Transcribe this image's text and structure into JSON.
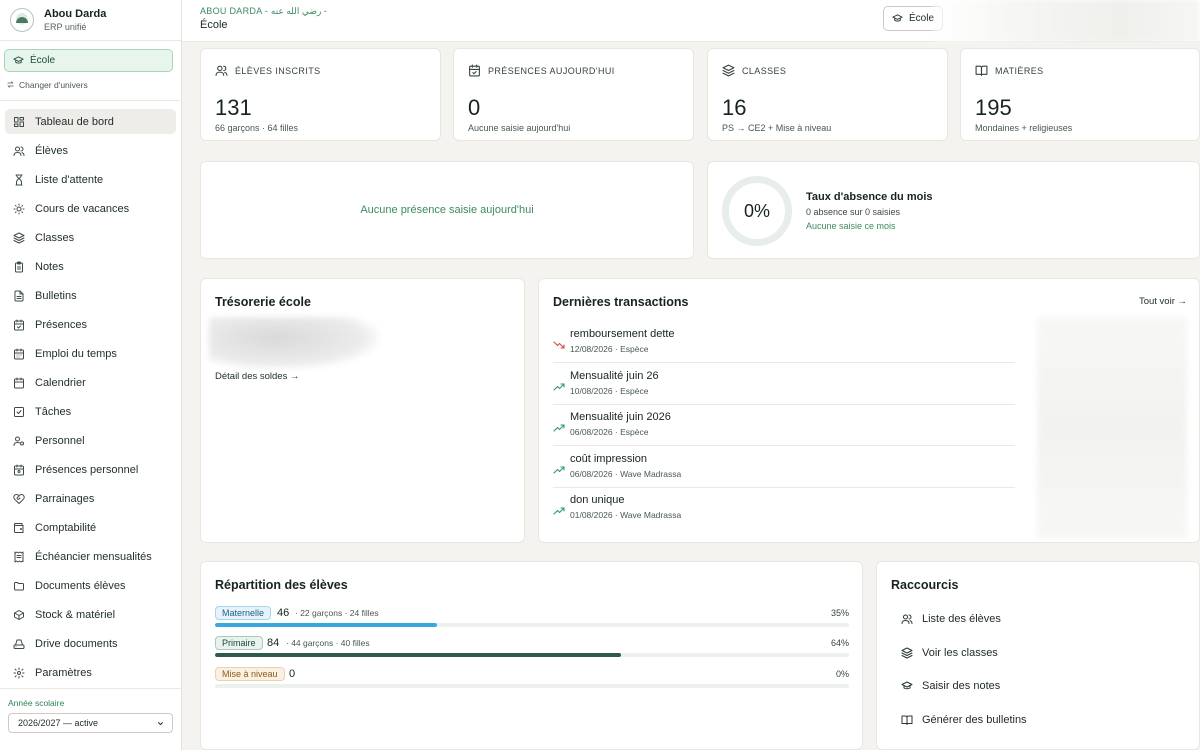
{
  "brand": {
    "name": "Abou Darda",
    "subtitle": "ERP unifié"
  },
  "univers": {
    "label": "École",
    "switch_label": "Changer d'univers"
  },
  "nav": [
    {
      "label": "Tableau de bord",
      "icon": "dashboard-icon",
      "active": true
    },
    {
      "label": "Élèves",
      "icon": "users-icon"
    },
    {
      "label": "Liste d'attente",
      "icon": "hourglass-icon"
    },
    {
      "label": "Cours de vacances",
      "icon": "sun-icon"
    },
    {
      "label": "Classes",
      "icon": "layers-icon"
    },
    {
      "label": "Notes",
      "icon": "clipboard-icon"
    },
    {
      "label": "Bulletins",
      "icon": "file-icon"
    },
    {
      "label": "Présences",
      "icon": "calendar-check-icon"
    },
    {
      "label": "Emploi du temps",
      "icon": "calendar-grid-icon"
    },
    {
      "label": "Calendrier",
      "icon": "calendar-icon"
    },
    {
      "label": "Tâches",
      "icon": "checkbox-icon"
    },
    {
      "label": "Personnel",
      "icon": "user-gear-icon"
    },
    {
      "label": "Présences personnel",
      "icon": "calendar-user-icon"
    },
    {
      "label": "Parrainages",
      "icon": "heart-handshake-icon"
    },
    {
      "label": "Comptabilité",
      "icon": "wallet-icon"
    },
    {
      "label": "Échéancier mensualités",
      "icon": "receipt-icon"
    },
    {
      "label": "Documents élèves",
      "icon": "folder-icon"
    },
    {
      "label": "Stock & matériel",
      "icon": "box-icon"
    },
    {
      "label": "Drive documents",
      "icon": "drive-icon"
    },
    {
      "label": "Paramètres",
      "icon": "settings-icon"
    }
  ],
  "year": {
    "label": "Année scolaire",
    "value": "2026/2027 — active"
  },
  "header": {
    "breadcrumb": "ABOU DARDA - رضي الله عنه -",
    "title": "École",
    "school_button": "École"
  },
  "stats": [
    {
      "label": "ÉLÈVES INSCRITS",
      "value": "131",
      "sub": "66 garçons · 64 filles",
      "icon": "users-icon"
    },
    {
      "label": "PRÉSENCES AUJOURD'HUI",
      "value": "0",
      "sub": "Aucune saisie aujourd'hui",
      "icon": "calendar-check-icon"
    },
    {
      "label": "CLASSES",
      "value": "16",
      "sub": "PS → CE2 + Mise à niveau",
      "icon": "layers-icon"
    },
    {
      "label": "MATIÈRES",
      "value": "195",
      "sub": "Mondaines + religieuses",
      "icon": "book-open-icon"
    }
  ],
  "presence_empty": "Aucune présence saisie aujourd'hui",
  "absence": {
    "percent": "0%",
    "title": "Taux d'absence du mois",
    "sub": "0 absence sur 0 saisies",
    "note": "Aucune saisie ce mois"
  },
  "tresorerie": {
    "title": "Trésorerie école",
    "link": "Détail des soldes →"
  },
  "transactions": {
    "title": "Dernières transactions",
    "link": "Tout voir →",
    "items": [
      {
        "name": "remboursement dette",
        "meta": "12/08/2026 · Espèce",
        "direction": "down",
        "icon": "trend-down-icon"
      },
      {
        "name": "Mensualité juin 26",
        "meta": "10/08/2026 · Espèce",
        "direction": "up",
        "icon": "trend-up-icon"
      },
      {
        "name": "Mensualité juin 2026",
        "meta": "06/08/2026 · Espèce",
        "direction": "up",
        "icon": "trend-up-icon"
      },
      {
        "name": "coût impression",
        "meta": "06/08/2026 · Wave Madrassa",
        "direction": "up",
        "icon": "trend-up-icon"
      },
      {
        "name": "don unique",
        "meta": "01/08/2026 · Wave Madrassa",
        "direction": "up",
        "icon": "trend-up-icon"
      }
    ]
  },
  "repartition": {
    "title": "Répartition des élèves",
    "rows": [
      {
        "level": "Maternelle",
        "count": "46",
        "detail": "· 22 garçons · 24 filles",
        "percent": "35%",
        "fill": 0.35,
        "color": "#38a8e0",
        "badge_bg": "#e6f3fb",
        "badge_border": "#a9d4ee",
        "badge_color": "#1d5f86"
      },
      {
        "level": "Primaire",
        "count": "84",
        "detail": "· 44 garçons · 40 filles",
        "percent": "64%",
        "fill": 0.64,
        "color": "#2f5a4a",
        "badge_bg": "#e9f2ee",
        "badge_border": "#a9c9b9",
        "badge_color": "#22473a"
      },
      {
        "level": "Mise à niveau",
        "count": "0",
        "detail": "",
        "percent": "0%",
        "fill": 0,
        "color": "#e0a85a",
        "badge_bg": "#fbf1e3",
        "badge_border": "#ecd2ae",
        "badge_color": "#8a5a1c"
      }
    ]
  },
  "raccourcis": {
    "title": "Raccourcis",
    "items": [
      {
        "label": "Liste des élèves",
        "icon": "users-icon"
      },
      {
        "label": "Voir les classes",
        "icon": "layers-icon"
      },
      {
        "label": "Saisir des notes",
        "icon": "graduation-cap-icon"
      },
      {
        "label": "Générer des bulletins",
        "icon": "book-open-icon"
      }
    ]
  },
  "colors": {
    "accent": "#3a8a60",
    "brand_green": "#1e4b33",
    "background": "#f5f3ef"
  }
}
